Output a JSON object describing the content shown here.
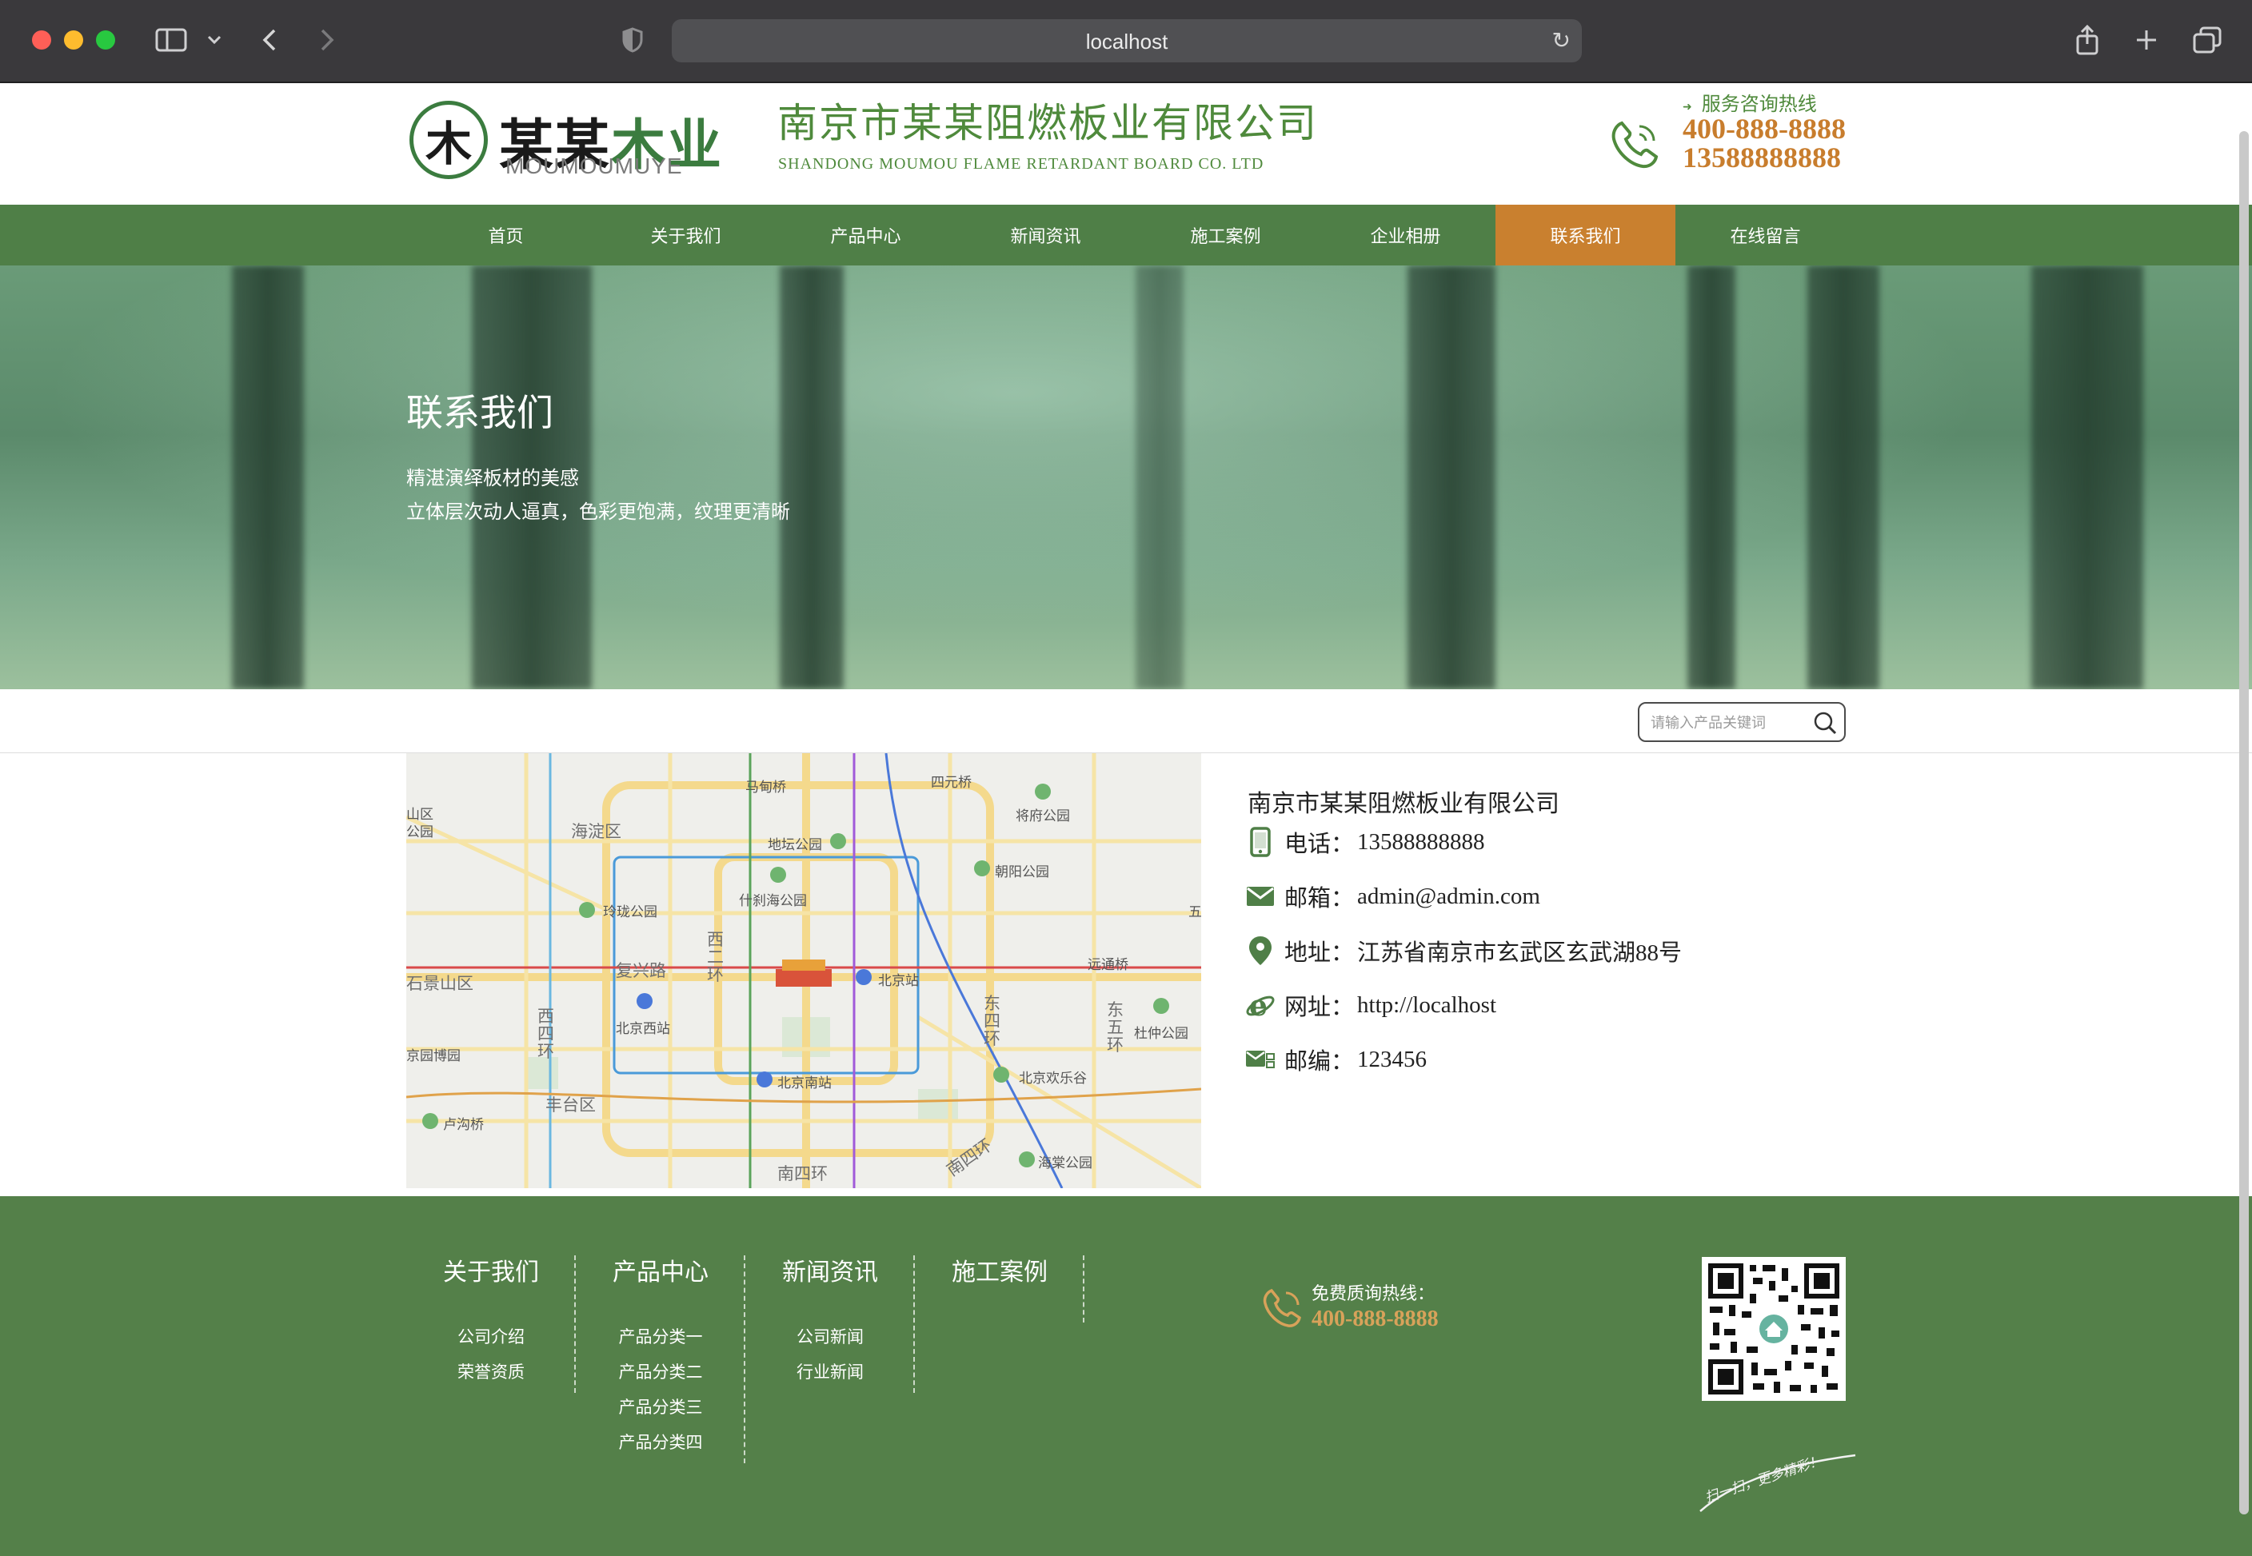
{
  "browser": {
    "address": "localhost"
  },
  "header": {
    "logo_glyph": "木",
    "logo_cn_black": "某某",
    "logo_cn_green": "木业",
    "logo_en": "MOUMOUMUYE",
    "company_cn": "南京市某某阻燃板业有限公司",
    "company_en": "SHANDONG MOUMOU FLAME RETARDANT BOARD CO. LTD",
    "hotline_label": "服务咨询热线",
    "hotline_1": "400-888-8888",
    "hotline_2": "13588888888"
  },
  "nav": {
    "items": [
      "首页",
      "关于我们",
      "产品中心",
      "新闻资讯",
      "施工案例",
      "企业相册",
      "联系我们",
      "在线留言"
    ],
    "active_index": 6
  },
  "banner": {
    "title": "联系我们",
    "subtitle_1": "精湛演绎板材的美感",
    "subtitle_2": "立体层次动人逼真，色彩更饱满，纹理更清晰"
  },
  "search": {
    "placeholder": "请输入产品关键词"
  },
  "map": {
    "labels": [
      "马甸桥",
      "四元桥",
      "将府公园",
      "海淀区",
      "地坛公园",
      "朝阳公园",
      "玲珑公园",
      "什刹海公园",
      "复兴路",
      "西二环",
      "北京站",
      "远通桥",
      "石景山区",
      "北京西站",
      "西四环",
      "东四环",
      "东五环",
      "杜仲公园",
      "丰台区",
      "北京南站",
      "北京欢乐谷",
      "南四环",
      "南四环",
      "海棠公园",
      "卢沟桥",
      "山区公园",
      "京园博园",
      "五"
    ]
  },
  "contact": {
    "company": "南京市某某阻燃板业有限公司",
    "rows": [
      {
        "icon": "mobile-phone-icon",
        "label": "电话：",
        "value": "13588888888"
      },
      {
        "icon": "envelope-icon",
        "label": "邮箱：",
        "value": "admin@admin.com"
      },
      {
        "icon": "location-pin-icon",
        "label": "地址：",
        "value": "江苏省南京市玄武区玄武湖88号"
      },
      {
        "icon": "browser-e-icon",
        "label": "网址：",
        "value": "http://localhost"
      },
      {
        "icon": "postcode-icon",
        "label": "邮编：",
        "value": "123456"
      }
    ]
  },
  "footer": {
    "columns": [
      {
        "title": "关于我们",
        "links": [
          "公司介绍",
          "荣誉资质"
        ]
      },
      {
        "title": "产品中心",
        "links": [
          "产品分类一",
          "产品分类二",
          "产品分类三",
          "产品分类四"
        ]
      },
      {
        "title": "新闻资讯",
        "links": [
          "公司新闻",
          "行业新闻"
        ]
      },
      {
        "title": "施工案例",
        "links": []
      }
    ],
    "free_line_label": "免费质询热线：",
    "free_line_number": "400-888-8888",
    "slogan": "扫一扫，更多精彩！"
  },
  "colors": {
    "brand_green": "#4f7f47",
    "accent_orange": "#c9802f",
    "footer_green": "#548049"
  }
}
